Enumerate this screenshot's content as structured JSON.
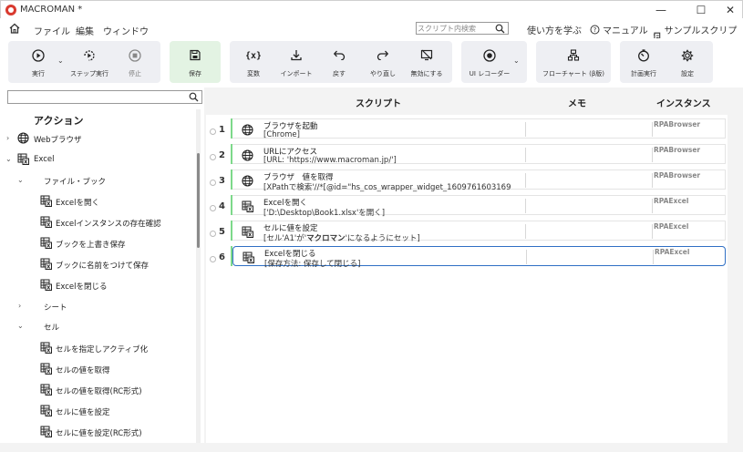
{
  "titlebar": {
    "title": "MACROMAN *",
    "minimize": "—",
    "maximize": "☐",
    "close": "✕"
  },
  "menu": {
    "items": [
      "ファイル",
      "編集",
      "ウィンドウ"
    ]
  },
  "search": {
    "placeholder": "スクリプト内検索",
    "value": ""
  },
  "help": {
    "learn": "使い方を学ぶ",
    "manual": "マニュアル",
    "samples": "サンプルスクリプト"
  },
  "toolbar": {
    "run": "実行",
    "step": "ステップ実行",
    "stop": "停止",
    "save": "保存",
    "variables": "変数",
    "import": "インポート",
    "undo": "戻す",
    "redo": "やり直し",
    "disable": "無効にする",
    "ui_recorder": "UI レコーダー",
    "flowchart": "フローチャート (β版)",
    "schedule": "計画実行",
    "settings": "設定"
  },
  "left": {
    "search_value": "",
    "title": "アクション",
    "web": "Webブラウザ",
    "excel": "Excel",
    "filebook": "ファイル・ブック",
    "sheet": "シート",
    "cell": "セル",
    "filebook_items": [
      "Excelを開く",
      "Excelインスタンスの存在確認",
      "ブックを上書き保存",
      "ブックに名前をつけて保存",
      "Excelを閉じる"
    ],
    "cell_items": [
      "セルを指定しアクティブ化",
      "セルの値を取得",
      "セルの値を取得(RC形式)",
      "セルに値を設定",
      "セルに値を設定(RC形式)"
    ]
  },
  "columns": {
    "script": "スクリプト",
    "memo": "メモ",
    "instance": "インスタンス"
  },
  "rows": [
    {
      "num": "1",
      "title": "ブラウザを起動",
      "sub": "[Chrome]",
      "instance": "RPABrowser",
      "icon": "globe-icon"
    },
    {
      "num": "2",
      "title": "URLにアクセス",
      "sub": "[URL: 'https://www.macroman.jp/']",
      "instance": "RPABrowser",
      "icon": "globe-icon"
    },
    {
      "num": "3",
      "title": "ブラウザ　値を取得",
      "sub": "[XPathで検索'//*[@id=\"hs_cos_wrapper_widget_1609761603169",
      "instance": "RPABrowser",
      "icon": "globe-icon"
    },
    {
      "num": "4",
      "title": "Excelを開く",
      "sub": "['D:\\Desktop\\Book1.xlsx'を開く]",
      "instance": "RPAExcel",
      "icon": "excel-icon"
    },
    {
      "num": "5",
      "title": "セルに値を設定",
      "sub_a": "[セル'A1'が'",
      "sub_b": "マクロマン",
      "sub_c": "'になるようにセット]",
      "instance": "RPAExcel",
      "icon": "excel-icon"
    },
    {
      "num": "6",
      "title": "Excelを閉じる",
      "sub": "[保存方法: 保存して閉じる]",
      "instance": "RPAExcel",
      "icon": "excel-icon"
    }
  ]
}
